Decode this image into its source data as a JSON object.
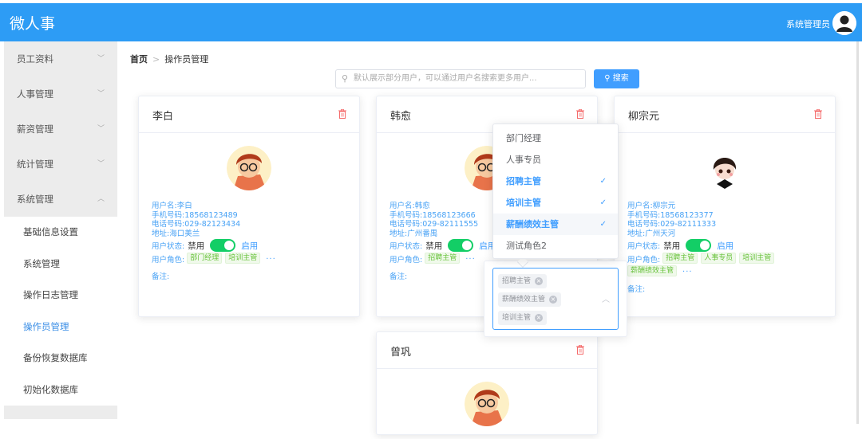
{
  "header": {
    "app_title": "微人事",
    "user_name": "系统管理员",
    "avatar_icon": "user-avatar-icon",
    "brand_color": "#2d9cf5"
  },
  "sidebar": {
    "menus": [
      {
        "label": "员工资料",
        "expanded": false
      },
      {
        "label": "人事管理",
        "expanded": false
      },
      {
        "label": "薪资管理",
        "expanded": false
      },
      {
        "label": "统计管理",
        "expanded": false
      },
      {
        "label": "系统管理",
        "expanded": true
      }
    ],
    "submenu": [
      {
        "label": "基础信息设置",
        "active": false
      },
      {
        "label": "系统管理",
        "active": false
      },
      {
        "label": "操作日志管理",
        "active": false
      },
      {
        "label": "操作员管理",
        "active": true
      },
      {
        "label": "备份恢复数据库",
        "active": false
      },
      {
        "label": "初始化数据库",
        "active": false
      }
    ]
  },
  "breadcrumb": {
    "home": "首页",
    "separator": ">",
    "current": "操作员管理"
  },
  "search": {
    "placeholder": "默认展示部分用户，可以通过用户名搜索更多用户...",
    "value": "",
    "button_label": "搜索"
  },
  "labels": {
    "username": "用户名:",
    "mobile": "手机号码:",
    "phone": "电话号码:",
    "address": "地址:",
    "status": "用户状态:",
    "disabled": "禁用",
    "enabled": "启用",
    "roles": "用户角色:",
    "more": "···",
    "note": "备注:"
  },
  "cards": [
    {
      "name": "李白",
      "username": "李白",
      "mobile": "18568123489",
      "phone": "029-82123434",
      "address": "海口美兰",
      "enabled": true,
      "roles": [
        "部门经理",
        "培训主管"
      ]
    },
    {
      "name": "韩愈",
      "username": "韩愈",
      "mobile": "18568123666",
      "phone": "029-82111555",
      "address": "广州番禺",
      "enabled": true,
      "roles": [
        "招聘主管"
      ]
    },
    {
      "name": "柳宗元",
      "username": "柳宗元",
      "mobile": "18568123377",
      "phone": "029-82111333",
      "address": "广州天河",
      "enabled": true,
      "roles": [
        "招聘主管",
        "人事专员",
        "培训主管",
        "薪酬绩效主管"
      ]
    },
    {
      "name": "曾巩"
    }
  ],
  "role_dropdown": {
    "options": [
      {
        "label": "部门经理",
        "selected": false
      },
      {
        "label": "人事专员",
        "selected": false
      },
      {
        "label": "招聘主管",
        "selected": true
      },
      {
        "label": "培训主管",
        "selected": true
      },
      {
        "label": "薪酬绩效主管",
        "selected": true
      },
      {
        "label": "测试角色2",
        "selected": false
      }
    ],
    "check_icon": "✓",
    "selected_tags": [
      "招聘主管",
      "薪酬绩效主管",
      "培训主管"
    ]
  }
}
